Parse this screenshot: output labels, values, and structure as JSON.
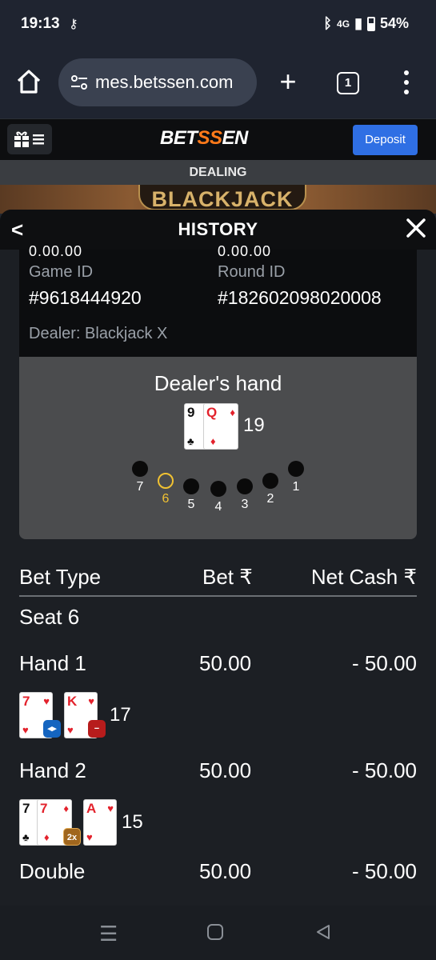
{
  "status": {
    "time": "19:13",
    "battery": "54%",
    "signal": "4G"
  },
  "browser": {
    "url": "mes.betssen.com",
    "tab_count": "1"
  },
  "site": {
    "logo_prefix": "BET",
    "logo_mid": "SS",
    "logo_suffix": "EN",
    "deposit_label": "Deposit"
  },
  "game": {
    "status": "DEALING",
    "title": "BLACKJACK"
  },
  "history": {
    "title": "HISTORY",
    "cut_left": "0.00.00",
    "cut_right": "0.00.00",
    "game_id_label": "Game ID",
    "game_id": "#9618444920",
    "round_id_label": "Round ID",
    "round_id": "#182602098020008",
    "dealer": "Dealer: Blackjack X",
    "dealers_hand_label": "Dealer's hand",
    "dealer_cards": [
      {
        "rank": "9",
        "suit": "♣",
        "color": "black"
      },
      {
        "rank": "Q",
        "suit": "♦",
        "color": "red"
      }
    ],
    "dealer_total": "19",
    "seats": [
      "7",
      "6",
      "5",
      "4",
      "3",
      "2",
      "1"
    ],
    "active_seat": "6"
  },
  "bets": {
    "columns": [
      "Bet Type",
      "Bet ₹",
      "Net Cash ₹"
    ],
    "seat_label": "Seat 6",
    "rows": [
      {
        "type": "Hand 1",
        "bet": "50.00",
        "net": "- 50.00"
      },
      {
        "type": "Hand 2",
        "bet": "50.00",
        "net": "- 50.00"
      },
      {
        "type": "Double",
        "bet": "50.00",
        "net": "- 50.00"
      }
    ],
    "hand1_cards": [
      {
        "rank": "7",
        "suit": "♥",
        "color": "red"
      },
      {
        "rank": "K",
        "suit": "♥",
        "color": "red"
      }
    ],
    "hand1_total": "17",
    "hand1_chips": [
      "split",
      "minus"
    ],
    "hand2_cards": [
      {
        "rank": "7",
        "suit": "♣",
        "color": "black"
      },
      {
        "rank": "7",
        "suit": "♦",
        "color": "red"
      },
      {
        "rank": "A",
        "suit": "♥",
        "color": "red"
      }
    ],
    "hand2_total": "15",
    "hand2_chip": "2x"
  }
}
